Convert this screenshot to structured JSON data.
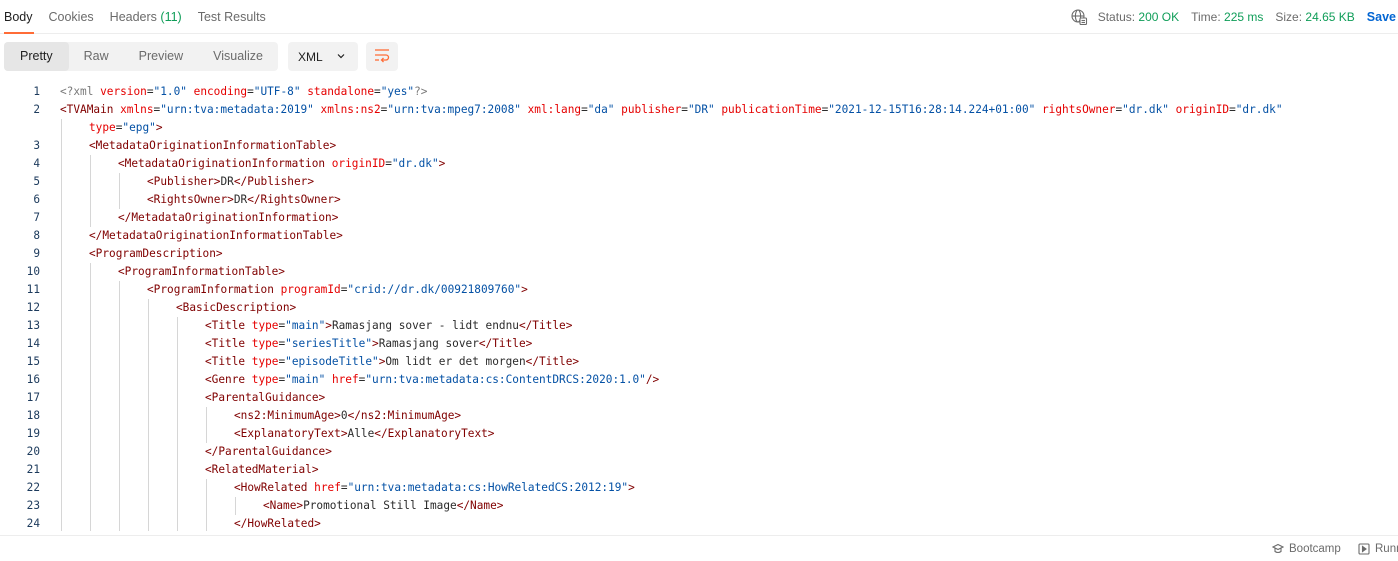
{
  "tabs": [
    {
      "label": "Body",
      "active": true
    },
    {
      "label": "Cookies"
    },
    {
      "label": "Headers",
      "count": "(11)"
    },
    {
      "label": "Test Results"
    }
  ],
  "status": {
    "status_label": "Status:",
    "status_value": "200 OK",
    "time_label": "Time:",
    "time_value": "225 ms",
    "size_label": "Size:",
    "size_value": "24.65 KB",
    "save_label": "Save"
  },
  "toolbar": {
    "views": [
      "Pretty",
      "Raw",
      "Preview",
      "Visualize"
    ],
    "active_view": "Pretty",
    "format": "XML"
  },
  "code_lines": [
    {
      "n": "1",
      "indent": 0,
      "html": "<span class=\"p\">&lt;?xml</span> <span class=\"a\">version</span>=<span class=\"s\">\"1.0\"</span> <span class=\"a\">encoding</span>=<span class=\"s\">\"UTF-8\"</span> <span class=\"a\">standalone</span>=<span class=\"s\">\"yes\"</span><span class=\"p\">?&gt;</span>"
    },
    {
      "n": "2",
      "indent": 0,
      "html": "<span class=\"tg\">&lt;TVAMain</span> <span class=\"a\">xmlns</span>=<span class=\"s\">\"urn:tva:metadata:2019\"</span> <span class=\"a\">xmlns:ns2</span>=<span class=\"s\">\"urn:tva:mpeg7:2008\"</span> <span class=\"a\">xml:lang</span>=<span class=\"s\">\"da\"</span> <span class=\"a\">publisher</span>=<span class=\"s\">\"DR\"</span> <span class=\"a\">publicationTime</span>=<span class=\"s\">\"2021-12-15T16:28:14.224+01:00\"</span> <span class=\"a\">rightsOwner</span>=<span class=\"s\">\"dr.dk\"</span> <span class=\"a\">originID</span>=<span class=\"s\">\"dr.dk\"</span>"
    },
    {
      "n": "",
      "indent": 1,
      "html": "<span class=\"a\">type</span>=<span class=\"s\">\"epg\"</span><span class=\"tg\">&gt;</span>"
    },
    {
      "n": "3",
      "indent": 1,
      "html": "<span class=\"tg\">&lt;MetadataOriginationInformationTable&gt;</span>"
    },
    {
      "n": "4",
      "indent": 2,
      "html": "<span class=\"tg\">&lt;MetadataOriginationInformation</span> <span class=\"a\">originID</span>=<span class=\"s\">\"dr.dk\"</span><span class=\"tg\">&gt;</span>"
    },
    {
      "n": "5",
      "indent": 3,
      "html": "<span class=\"tg\">&lt;Publisher&gt;</span>DR<span class=\"tg\">&lt;/Publisher&gt;</span>"
    },
    {
      "n": "6",
      "indent": 3,
      "html": "<span class=\"tg\">&lt;RightsOwner&gt;</span>DR<span class=\"tg\">&lt;/RightsOwner&gt;</span>"
    },
    {
      "n": "7",
      "indent": 2,
      "html": "<span class=\"tg\">&lt;/MetadataOriginationInformation&gt;</span>"
    },
    {
      "n": "8",
      "indent": 1,
      "html": "<span class=\"tg\">&lt;/MetadataOriginationInformationTable&gt;</span>"
    },
    {
      "n": "9",
      "indent": 1,
      "html": "<span class=\"tg\">&lt;ProgramDescription&gt;</span>"
    },
    {
      "n": "10",
      "indent": 2,
      "html": "<span class=\"tg\">&lt;ProgramInformationTable&gt;</span>"
    },
    {
      "n": "11",
      "indent": 3,
      "html": "<span class=\"tg\">&lt;ProgramInformation</span> <span class=\"a\">programId</span>=<span class=\"s\">\"crid://dr.dk/00921809760\"</span><span class=\"tg\">&gt;</span>"
    },
    {
      "n": "12",
      "indent": 4,
      "html": "<span class=\"tg\">&lt;BasicDescription&gt;</span>"
    },
    {
      "n": "13",
      "indent": 5,
      "html": "<span class=\"tg\">&lt;Title</span> <span class=\"a\">type</span>=<span class=\"s\">\"main\"</span><span class=\"tg\">&gt;</span>Ramasjang sover - lidt endnu<span class=\"tg\">&lt;/Title&gt;</span>"
    },
    {
      "n": "14",
      "indent": 5,
      "html": "<span class=\"tg\">&lt;Title</span> <span class=\"a\">type</span>=<span class=\"s\">\"seriesTitle\"</span><span class=\"tg\">&gt;</span>Ramasjang sover<span class=\"tg\">&lt;/Title&gt;</span>"
    },
    {
      "n": "15",
      "indent": 5,
      "html": "<span class=\"tg\">&lt;Title</span> <span class=\"a\">type</span>=<span class=\"s\">\"episodeTitle\"</span><span class=\"tg\">&gt;</span>Om lidt er det morgen<span class=\"tg\">&lt;/Title&gt;</span>"
    },
    {
      "n": "16",
      "indent": 5,
      "html": "<span class=\"tg\">&lt;Genre</span> <span class=\"a\">type</span>=<span class=\"s\">\"main\"</span> <span class=\"a\">href</span>=<span class=\"s\">\"urn:tva:metadata:cs:ContentDRCS:2020:1.0\"</span><span class=\"tg\">/&gt;</span>"
    },
    {
      "n": "17",
      "indent": 5,
      "html": "<span class=\"tg\">&lt;ParentalGuidance&gt;</span>"
    },
    {
      "n": "18",
      "indent": 6,
      "html": "<span class=\"tg\">&lt;ns2:MinimumAge&gt;</span>0<span class=\"tg\">&lt;/ns2:MinimumAge&gt;</span>"
    },
    {
      "n": "19",
      "indent": 6,
      "html": "<span class=\"tg\">&lt;ExplanatoryText&gt;</span>Alle<span class=\"tg\">&lt;/ExplanatoryText&gt;</span>"
    },
    {
      "n": "20",
      "indent": 5,
      "html": "<span class=\"tg\">&lt;/ParentalGuidance&gt;</span>"
    },
    {
      "n": "21",
      "indent": 5,
      "html": "<span class=\"tg\">&lt;RelatedMaterial&gt;</span>"
    },
    {
      "n": "22",
      "indent": 6,
      "html": "<span class=\"tg\">&lt;HowRelated</span> <span class=\"a\">href</span>=<span class=\"s\">\"urn:tva:metadata:cs:HowRelatedCS:2012:19\"</span><span class=\"tg\">&gt;</span>"
    },
    {
      "n": "23",
      "indent": 7,
      "html": "<span class=\"tg\">&lt;Name&gt;</span>Promotional Still Image<span class=\"tg\">&lt;/Name&gt;</span>"
    },
    {
      "n": "24",
      "indent": 6,
      "html": "<span class=\"tg\">&lt;/HowRelated&gt;</span>"
    }
  ],
  "footer": {
    "bootcamp": "Bootcamp",
    "runner": "Runn"
  }
}
